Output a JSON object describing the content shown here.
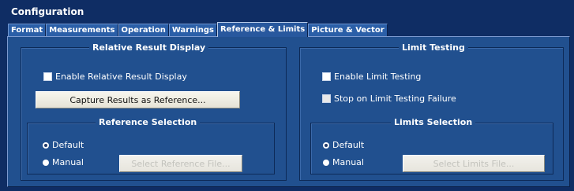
{
  "window": {
    "title": "Configuration"
  },
  "tabs": [
    {
      "label": "Format",
      "active": false
    },
    {
      "label": "Measurements",
      "active": false
    },
    {
      "label": "Operation",
      "active": false
    },
    {
      "label": "Warnings",
      "active": false
    },
    {
      "label": "Reference & Limits",
      "active": true
    },
    {
      "label": "Picture & Vector",
      "active": false
    }
  ],
  "relative": {
    "title": "Relative Result Display",
    "enable_label": "Enable Relative Result Display",
    "enable_checked": false,
    "capture_button": "Capture Results as Reference..."
  },
  "reference_selection": {
    "title": "Reference Selection",
    "default_label": "Default",
    "manual_label": "Manual",
    "selected": "Default",
    "select_button": "Select Reference File..."
  },
  "limit_testing": {
    "title": "Limit Testing",
    "enable_label": "Enable Limit Testing",
    "enable_checked": false,
    "stop_label": "Stop on Limit Testing Failure",
    "stop_checked": false
  },
  "limits_selection": {
    "title": "Limits Selection",
    "default_label": "Default",
    "manual_label": "Manual",
    "selected": "Default",
    "select_button": "Select Limits File..."
  }
}
